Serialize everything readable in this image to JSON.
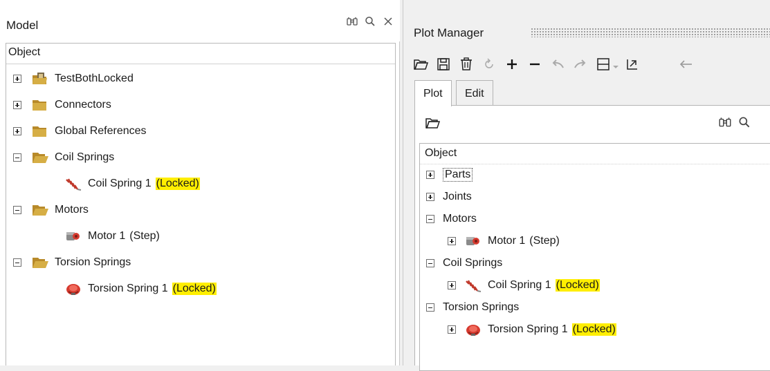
{
  "model_panel": {
    "title": "Model",
    "column_header": "Object",
    "tree": [
      {
        "label": "TestBothLocked",
        "expander": "+",
        "icon": "model-icon"
      },
      {
        "label": "Connectors",
        "expander": "+",
        "icon": "folder-icon"
      },
      {
        "label": "Global References",
        "expander": "+",
        "icon": "folder-icon"
      },
      {
        "label": "Coil Springs",
        "expander": "-",
        "icon": "folder-open-icon"
      },
      {
        "label": "Coil Spring 1",
        "suffix": "(Locked)",
        "icon": "coil-spring-icon"
      },
      {
        "label": "Motors",
        "expander": "-",
        "icon": "folder-open-icon"
      },
      {
        "label": "Motor 1",
        "suffix": "(Step)",
        "icon": "motor-icon"
      },
      {
        "label": "Torsion Springs",
        "expander": "-",
        "icon": "folder-open-icon"
      },
      {
        "label": "Torsion Spring 1",
        "suffix": "(Locked)",
        "icon": "torsion-spring-icon"
      }
    ]
  },
  "plot_panel": {
    "title": "Plot Manager",
    "toolbar": [
      "open-folder-icon",
      "save-icon",
      "delete-icon",
      "refresh-icon",
      "add-icon",
      "remove-icon",
      "undo-icon",
      "redo-icon",
      "layout-icon",
      "chevron-down-icon",
      "export-icon",
      "back-arrow-icon"
    ],
    "tabs": [
      "Plot",
      "Edit"
    ],
    "active_tab": "Plot",
    "column_header": "Object",
    "tree": [
      {
        "label": "Parts",
        "expander": "+"
      },
      {
        "label": "Joints",
        "expander": "+"
      },
      {
        "label": "Motors",
        "expander": "-"
      },
      {
        "label": "Motor 1",
        "suffix": "(Step)",
        "expander": "+",
        "icon": "motor-icon"
      },
      {
        "label": "Coil Springs",
        "expander": "-"
      },
      {
        "label": "Coil Spring 1",
        "suffix": "(Locked)",
        "expander": "+",
        "icon": "coil-spring-icon"
      },
      {
        "label": "Torsion Springs",
        "expander": "-"
      },
      {
        "label": "Torsion Spring 1",
        "suffix": "(Locked)",
        "expander": "+",
        "icon": "torsion-spring-icon"
      }
    ]
  },
  "colors": {
    "highlight": "#ffee00",
    "folder": "#c8a23a",
    "accent_red": "#d63a2f"
  }
}
